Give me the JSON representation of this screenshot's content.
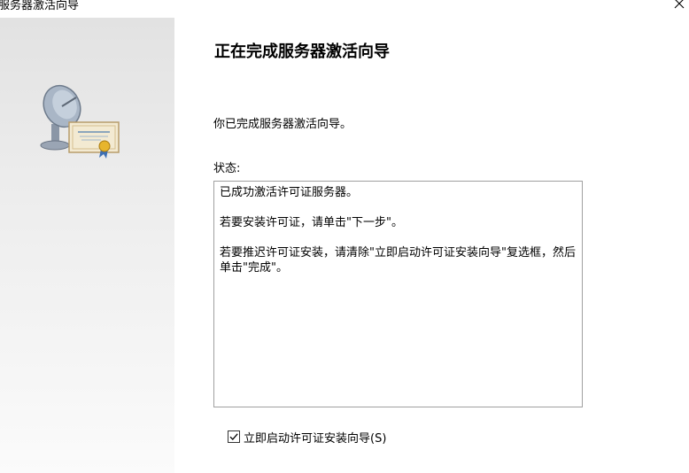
{
  "window": {
    "title": "服务器激活向导"
  },
  "wizard": {
    "heading": "正在完成服务器激活向导",
    "intro": "你已完成服务器激活向导。",
    "status_label": "状态:",
    "status_lines": [
      "已成功激活许可证服务器。",
      "若要安装许可证，请单击\"下一步\"。",
      "若要推迟许可证安装，请清除\"立即启动许可证安装向导\"复选框，然后单击\"完成\"。"
    ],
    "start_checkbox": {
      "label": "立即启动许可证安装向导(S)",
      "checked": true
    }
  },
  "icons": {
    "close": "close-icon",
    "wizard": "server-certificate-icon",
    "check": "checkmark-icon"
  }
}
